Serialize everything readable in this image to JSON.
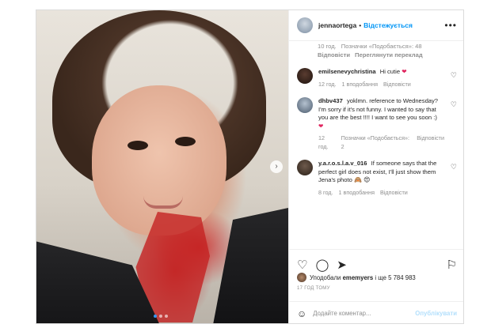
{
  "header": {
    "username": "jennaortega",
    "separator": "•",
    "follow_label": "Відстежується",
    "more_icon": "more-icon"
  },
  "comments": {
    "partial": {
      "meta1": "10 год.",
      "meta2": "Позначки «Подобається»: 48",
      "reply": "Відповісти",
      "translate": "Переглянути переклад"
    },
    "items": [
      {
        "username": "emilsenevychristina",
        "text": "Hi cutie",
        "emoji": "❤",
        "time": "12 год.",
        "likes": "1 вподобання",
        "reply": "Відповісти"
      },
      {
        "username": "dhbv437",
        "text": "yoklmn. reference to Wednesday? I'm sorry if it's not funny. I wanted to say that you are the best !!!! I want to see you soon :)",
        "emoji": "❤",
        "time": "12 год.",
        "likes": "Позначки «Подобається»: 2",
        "reply": "Відповісти"
      },
      {
        "username": "y.a.r.o.s.l.a.v_016",
        "text": "If someone says that the perfect girl does not exist, I'll just show them Jena's photo",
        "emoji": "🙈 😍",
        "time": "8 год.",
        "likes": "1 вподобання",
        "reply": "Відповісти"
      }
    ]
  },
  "likes_text_prefix": "Уподобали",
  "likes_user": "ememyers",
  "likes_text_suffix": "і ще 5 784 983",
  "time_ago": "17 ГОД ТОМУ",
  "add_comment": {
    "placeholder": "Додайте коментар...",
    "post_label": "Опублікувати"
  },
  "colors": {
    "follow": "#0095f6",
    "heart": "#e0245e",
    "post_disabled": "#b2dffc"
  }
}
